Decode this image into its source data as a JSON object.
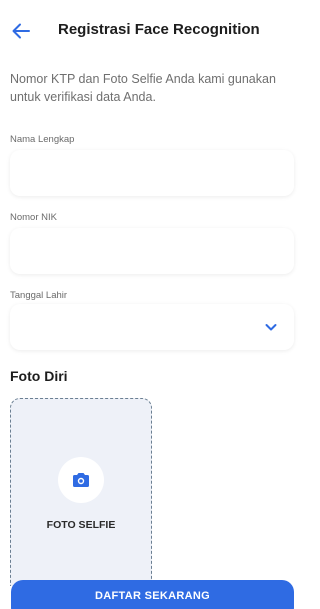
{
  "header": {
    "title": "Registrasi Face Recognition",
    "back_icon": "arrow-left-icon"
  },
  "intro": {
    "text": "Nomor KTP dan Foto Selfie Anda kami gunakan untuk verifikasi data Anda."
  },
  "form": {
    "full_name": {
      "label": "Nama Lengkap",
      "value": "",
      "placeholder": ""
    },
    "nik": {
      "label": "Nomor NIK",
      "value": "",
      "placeholder": ""
    },
    "birth_date": {
      "label": "Tanggal Lahir",
      "value": "",
      "icon": "chevron-down-icon"
    }
  },
  "photo": {
    "section_title": "Foto Diri",
    "selfie_label": "FOTO SELFIE",
    "icon": "camera-icon"
  },
  "submit": {
    "label": "DAFTAR SEKARANG"
  },
  "colors": {
    "accent": "#2f6be3",
    "upload_bg": "#eef1f8",
    "dashed_border": "#6b7f92"
  }
}
